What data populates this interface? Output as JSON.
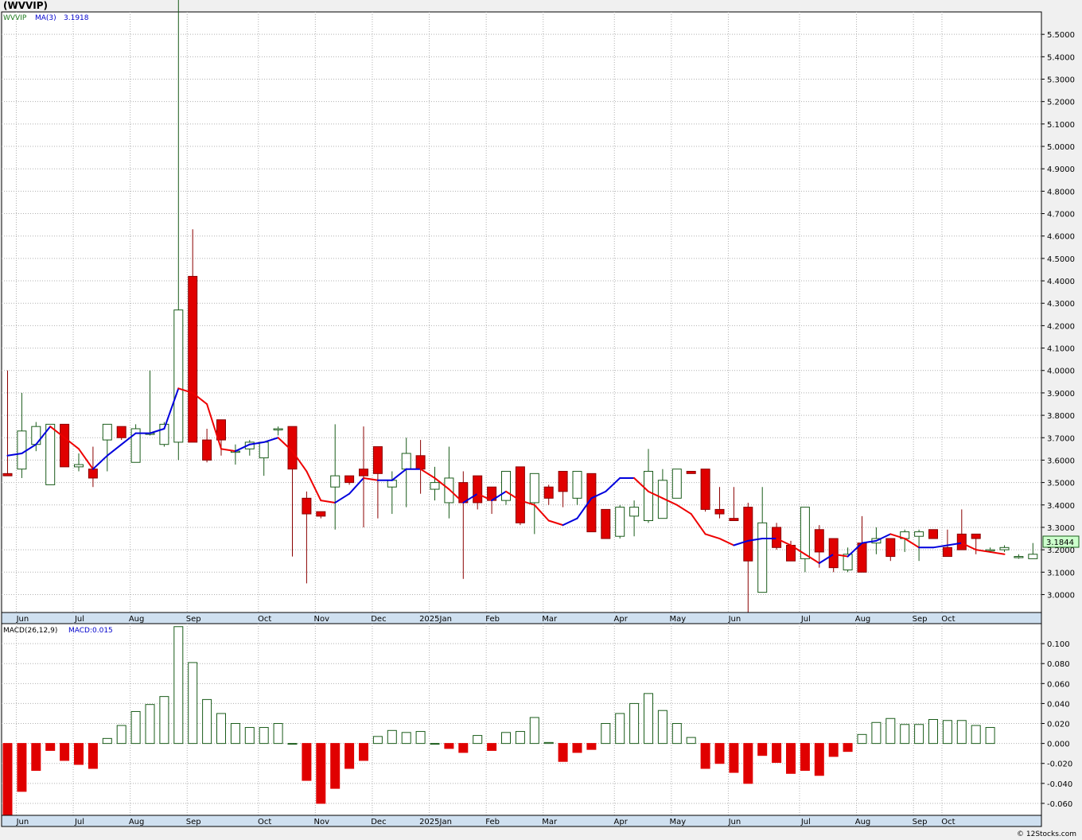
{
  "header": {
    "ticker_title": "(WVVIP)",
    "credit": "© 12Stocks.com"
  },
  "price_panel": {
    "legend_symbol": "WVVIP",
    "legend_ma": "MA(3)",
    "legend_ma_value": "3.1918",
    "last_price_label": "3.1844",
    "y_ticks": [
      3.0,
      3.1,
      3.2,
      3.3,
      3.4,
      3.5,
      3.6,
      3.7,
      3.8,
      3.9,
      4.0,
      4.1,
      4.2,
      4.3,
      4.4,
      4.5,
      4.6,
      4.7,
      4.8,
      4.9,
      5.0,
      5.1,
      5.2,
      5.3,
      5.4,
      5.5
    ],
    "y_tick_labels": [
      "3.0000",
      "3.1000",
      "3.2000",
      "3.3000",
      "3.4000",
      "3.5000",
      "3.6000",
      "3.7000",
      "3.8000",
      "3.9000",
      "4.0000",
      "4.1000",
      "4.2000",
      "4.3000",
      "4.4000",
      "4.5000",
      "4.6000",
      "4.7000",
      "4.8000",
      "4.9000",
      "5.0000",
      "5.1000",
      "5.2000",
      "5.3000",
      "5.4000",
      "5.5000"
    ]
  },
  "macd_panel": {
    "legend_name": "MACD(26,12,9)",
    "legend_value": "MACD:0.015",
    "y_ticks": [
      -0.06,
      -0.04,
      -0.02,
      0,
      0.02,
      0.04,
      0.06,
      0.08,
      0.1
    ],
    "y_tick_labels": [
      "-0.060",
      "-0.040",
      "-0.020",
      "0.000",
      "0.020",
      "0.040",
      "0.060",
      "0.080",
      "0.100"
    ]
  },
  "x_axis": {
    "labels": [
      "Jun",
      "Jul",
      "Aug",
      "Sep",
      "Oct",
      "Nov",
      "Dec",
      "2025Jan",
      "Feb",
      "Mar",
      "Apr",
      "May",
      "Jun",
      "Jul",
      "Aug",
      "Sep",
      "Oct"
    ],
    "label_weeks": [
      1,
      5,
      9,
      13,
      18,
      22,
      26,
      30,
      34,
      38,
      43,
      47,
      51,
      56,
      60,
      64,
      66
    ]
  },
  "colors": {
    "up": "#1a5c1a",
    "down": "#e00000",
    "ma_up": "#0000dd",
    "ma_down": "#ee0000",
    "grid": "#b0b0b0",
    "label_box": "#ccffcc"
  },
  "chart_data": [
    {
      "type": "candlestick",
      "title": "(WVVIP)",
      "x_unit": "weekly bars, Jun 2024 - Oct 2025",
      "ylim": [
        2.92,
        5.6
      ],
      "grid": true,
      "series": [
        {
          "name": "WVVIP",
          "ohlc": [
            [
              3.54,
              4.0,
              3.53,
              3.53
            ],
            [
              3.56,
              3.9,
              3.52,
              3.73
            ],
            [
              3.67,
              3.77,
              3.64,
              3.75
            ],
            [
              3.49,
              3.76,
              3.49,
              3.76
            ],
            [
              3.76,
              3.76,
              3.57,
              3.57
            ],
            [
              3.57,
              3.63,
              3.55,
              3.58
            ],
            [
              3.56,
              3.66,
              3.48,
              3.52
            ],
            [
              3.69,
              3.76,
              3.55,
              3.76
            ],
            [
              3.75,
              3.75,
              3.69,
              3.7
            ],
            [
              3.59,
              3.76,
              3.59,
              3.74
            ],
            [
              3.72,
              4.0,
              3.71,
              3.72
            ],
            [
              3.67,
              3.77,
              3.66,
              3.76
            ],
            [
              3.68,
              5.79,
              3.6,
              4.27
            ],
            [
              4.42,
              4.63,
              3.69,
              3.68
            ],
            [
              3.69,
              3.74,
              3.59,
              3.6
            ],
            [
              3.78,
              3.78,
              3.62,
              3.69
            ],
            [
              3.64,
              3.67,
              3.58,
              3.64
            ],
            [
              3.65,
              3.69,
              3.62,
              3.68
            ],
            [
              3.61,
              3.68,
              3.53,
              3.68
            ],
            [
              3.74,
              3.75,
              3.71,
              3.74
            ],
            [
              3.75,
              3.75,
              3.17,
              3.56
            ],
            [
              3.43,
              3.46,
              3.05,
              3.36
            ],
            [
              3.37,
              3.37,
              3.34,
              3.35
            ],
            [
              3.48,
              3.76,
              3.29,
              3.53
            ],
            [
              3.53,
              3.53,
              3.49,
              3.5
            ],
            [
              3.56,
              3.75,
              3.3,
              3.53
            ],
            [
              3.66,
              3.66,
              3.34,
              3.54
            ],
            [
              3.48,
              3.55,
              3.36,
              3.51
            ],
            [
              3.56,
              3.7,
              3.39,
              3.63
            ],
            [
              3.62,
              3.69,
              3.45,
              3.56
            ],
            [
              3.47,
              3.57,
              3.42,
              3.5
            ],
            [
              3.41,
              3.66,
              3.34,
              3.52
            ],
            [
              3.5,
              3.55,
              3.07,
              3.41
            ],
            [
              3.53,
              3.53,
              3.38,
              3.41
            ],
            [
              3.48,
              3.48,
              3.36,
              3.42
            ],
            [
              3.42,
              3.55,
              3.4,
              3.55
            ],
            [
              3.57,
              3.57,
              3.31,
              3.32
            ],
            [
              3.41,
              3.54,
              3.27,
              3.54
            ],
            [
              3.48,
              3.49,
              3.4,
              3.43
            ],
            [
              3.55,
              3.55,
              3.39,
              3.46
            ],
            [
              3.43,
              3.55,
              3.4,
              3.55
            ],
            [
              3.54,
              3.54,
              3.28,
              3.28
            ],
            [
              3.38,
              3.38,
              3.25,
              3.25
            ],
            [
              3.26,
              3.4,
              3.25,
              3.39
            ],
            [
              3.35,
              3.42,
              3.26,
              3.39
            ],
            [
              3.33,
              3.65,
              3.32,
              3.55
            ],
            [
              3.34,
              3.56,
              3.34,
              3.51
            ],
            [
              3.43,
              3.56,
              3.43,
              3.56
            ],
            [
              3.55,
              3.55,
              3.54,
              3.54
            ],
            [
              3.56,
              3.56,
              3.37,
              3.38
            ],
            [
              3.38,
              3.48,
              3.34,
              3.36
            ],
            [
              3.34,
              3.48,
              3.33,
              3.33
            ],
            [
              3.39,
              3.41,
              2.92,
              3.15
            ],
            [
              3.01,
              3.48,
              3.01,
              3.32
            ],
            [
              3.3,
              3.32,
              3.2,
              3.21
            ],
            [
              3.22,
              3.24,
              3.15,
              3.15
            ],
            [
              3.16,
              3.39,
              3.1,
              3.39
            ],
            [
              3.29,
              3.31,
              3.12,
              3.19
            ],
            [
              3.25,
              3.25,
              3.1,
              3.12
            ],
            [
              3.11,
              3.21,
              3.1,
              3.18
            ],
            [
              3.23,
              3.35,
              3.1,
              3.1
            ],
            [
              3.23,
              3.3,
              3.18,
              3.25
            ],
            [
              3.25,
              3.25,
              3.15,
              3.17
            ],
            [
              3.25,
              3.29,
              3.19,
              3.28
            ],
            [
              3.26,
              3.29,
              3.15,
              3.28
            ],
            [
              3.29,
              3.29,
              3.25,
              3.25
            ],
            [
              3.21,
              3.29,
              3.17,
              3.17
            ],
            [
              3.27,
              3.38,
              3.2,
              3.2
            ],
            [
              3.27,
              3.27,
              3.18,
              3.25
            ],
            [
              3.2,
              3.21,
              3.2,
              3.2
            ],
            [
              3.2,
              3.22,
              3.19,
              3.21
            ],
            [
              3.17,
              3.18,
              3.16,
              3.17
            ],
            [
              3.16,
              3.23,
              3.16,
              3.18
            ]
          ]
        },
        {
          "name": "MA(3)",
          "values": [
            3.62,
            3.63,
            3.67,
            3.75,
            3.7,
            3.65,
            3.56,
            3.62,
            3.67,
            3.72,
            3.72,
            3.74,
            3.92,
            3.9,
            3.85,
            3.65,
            3.64,
            3.67,
            3.68,
            3.7,
            3.64,
            3.55,
            3.42,
            3.41,
            3.45,
            3.52,
            3.51,
            3.51,
            3.56,
            3.56,
            3.52,
            3.47,
            3.41,
            3.45,
            3.42,
            3.46,
            3.42,
            3.4,
            3.33,
            3.31,
            3.34,
            3.43,
            3.46,
            3.52,
            3.52,
            3.46,
            3.43,
            3.4,
            3.36,
            3.27,
            3.25,
            3.22,
            3.24,
            3.25,
            3.25,
            3.22,
            3.18,
            3.14,
            3.18,
            3.17,
            3.23,
            3.24,
            3.27,
            3.25,
            3.21,
            3.21,
            3.22,
            3.23,
            3.2,
            3.19,
            3.18
          ]
        }
      ]
    },
    {
      "type": "bar",
      "title": "MACD(26,12,9)",
      "ylim": [
        -0.072,
        0.12
      ],
      "grid": true,
      "series": [
        {
          "name": "MACD",
          "values": [
            -0.075,
            -0.048,
            -0.027,
            -0.007,
            -0.017,
            -0.021,
            -0.025,
            0.005,
            0.018,
            0.032,
            0.039,
            0.047,
            0.117,
            0.081,
            0.044,
            0.03,
            0.02,
            0.016,
            0.016,
            0.02,
            0.0,
            -0.037,
            -0.06,
            -0.045,
            -0.025,
            -0.017,
            0.007,
            0.013,
            0.011,
            0.012,
            0.0,
            -0.005,
            -0.009,
            0.008,
            -0.007,
            0.011,
            0.012,
            0.026,
            0.001,
            -0.018,
            -0.009,
            -0.006,
            0.02,
            0.03,
            0.04,
            0.05,
            0.033,
            0.02,
            0.006,
            -0.025,
            -0.02,
            -0.029,
            -0.04,
            -0.012,
            -0.019,
            -0.03,
            -0.027,
            -0.032,
            -0.013,
            -0.008,
            0.009,
            0.021,
            0.025,
            0.019,
            0.019,
            0.024,
            0.023,
            0.023,
            0.018,
            0.016
          ]
        }
      ]
    }
  ]
}
